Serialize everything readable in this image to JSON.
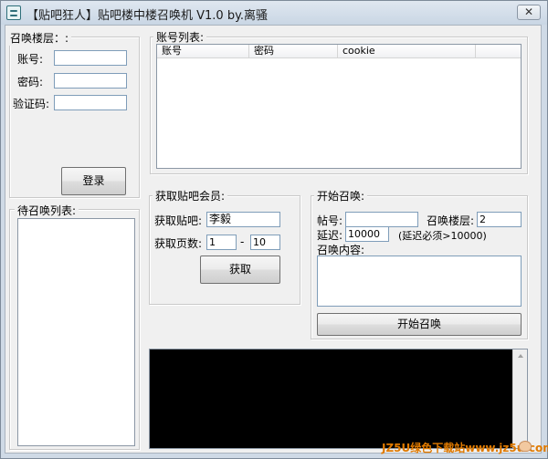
{
  "window": {
    "title": "【贴吧狂人】贴吧楼中楼召唤机 V1.0   by.离骚",
    "close_symbol": "✕"
  },
  "login": {
    "group_label": "召唤楼层：:",
    "account_label": "账号:",
    "password_label": "密码:",
    "captcha_label": "验证码:",
    "account_value": "",
    "password_value": "",
    "captcha_value": "",
    "login_button": "登录"
  },
  "accounts": {
    "group_label": "账号列表:",
    "columns": [
      "账号",
      "密码",
      "cookie"
    ]
  },
  "pending": {
    "group_label": "待召唤列表:"
  },
  "fetch": {
    "group_label": "获取贴吧会员:",
    "forum_label": "获取贴吧:",
    "forum_value": "李毅",
    "pages_label": "获取页数:",
    "page_from": "1",
    "dash": "-",
    "page_to": "10",
    "fetch_button": "获取"
  },
  "summon": {
    "group_label": "开始召唤:",
    "post_label": "帖号:",
    "post_value": "",
    "floor_label": "召唤楼层:",
    "floor_value": "2",
    "delay_label": "延迟:",
    "delay_value": "10000",
    "delay_note": "(延迟必须>10000)",
    "content_label": "召唤内容:",
    "content_value": "",
    "start_button": "开始召唤"
  },
  "watermark": "JZ5U绿色下载站www.jz5u.com",
  "colors": {
    "console_bg": "#000000",
    "window_bg": "#f0f0f0",
    "watermark": "#e07a00"
  }
}
